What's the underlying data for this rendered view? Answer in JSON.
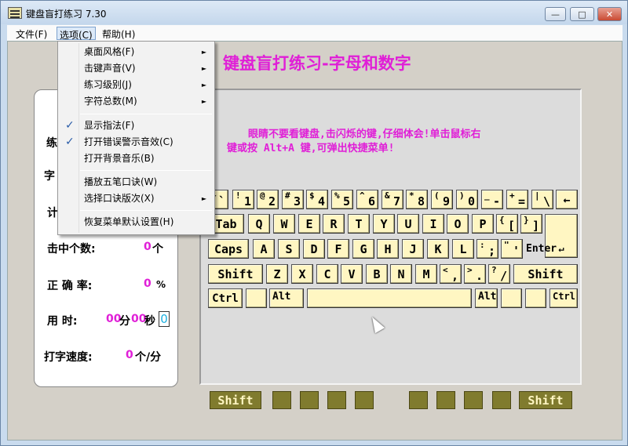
{
  "window": {
    "title": "键盘盲打练习 7.30",
    "buttons": {
      "minimize": "—",
      "maximize": "□",
      "close": "✕"
    }
  },
  "menubar": {
    "items": [
      "文件(F)",
      "选项(C)",
      "帮助(H)"
    ]
  },
  "options_menu": {
    "items": [
      {
        "label": "桌面风格(F)",
        "submenu": true,
        "checked": false
      },
      {
        "label": "击键声音(V)",
        "submenu": true,
        "checked": false
      },
      {
        "label": "练习级别(J)",
        "submenu": true,
        "checked": false
      },
      {
        "label": "字符总数(M)",
        "submenu": true,
        "checked": false
      },
      {
        "label": "显示指法(F)",
        "submenu": false,
        "checked": true
      },
      {
        "label": "打开错误警示音效(C)",
        "submenu": false,
        "checked": true
      },
      {
        "label": "打开背景音乐(B)",
        "submenu": false,
        "checked": false
      },
      {
        "label": "播放五笔口诀(W)",
        "submenu": false,
        "checked": false
      },
      {
        "label": "选择口诀版次(X)",
        "submenu": true,
        "checked": false
      },
      {
        "label": "恢复菜单默认设置(H)",
        "submenu": false,
        "checked": false
      }
    ],
    "arrow": "►",
    "check": "✓"
  },
  "heading": "键盘盲打练习-字母和数字",
  "hint": {
    "line1": "眼睛不要看键盘,击闪烁的键,仔细体会!单击鼠标右",
    "line2": "键或按 Alt+A 键,可弹出快捷菜单!"
  },
  "stats": {
    "partial_label_1": "练",
    "partial_label_2": "字",
    "partial_label_3": "计",
    "hits_label": "击中个数:",
    "hits_value": "0",
    "hits_unit": "个",
    "accuracy_label": "正 确 率:",
    "accuracy_value": "0",
    "accuracy_unit": "%",
    "time_label": "用  时:",
    "time_min": "00",
    "time_min_unit": "分",
    "time_sec": "00",
    "time_sec_unit": "秒",
    "time_box": "0",
    "speed_label": "打字速度:",
    "speed_value": "0",
    "speed_unit": "个/分"
  },
  "keyboard": {
    "row1": [
      {
        "top": "~",
        "bottom": "`"
      },
      {
        "top": "!",
        "bottom": "1"
      },
      {
        "top": "@",
        "bottom": "2"
      },
      {
        "top": "#",
        "bottom": "3"
      },
      {
        "top": "$",
        "bottom": "4"
      },
      {
        "top": "%",
        "bottom": "5"
      },
      {
        "top": "^",
        "bottom": "6"
      },
      {
        "top": "&",
        "bottom": "7"
      },
      {
        "top": "*",
        "bottom": "8"
      },
      {
        "top": "(",
        "bottom": "9"
      },
      {
        "top": ")",
        "bottom": "0"
      },
      {
        "top": "_",
        "bottom": "-"
      },
      {
        "top": "+",
        "bottom": "="
      },
      {
        "top": "|",
        "bottom": "\\"
      },
      {
        "top": "",
        "bottom": "←"
      }
    ],
    "row2": [
      "Tab",
      "Q",
      "W",
      "E",
      "R",
      "T",
      "Y",
      "U",
      "I",
      "O",
      "P"
    ],
    "row2_dual": [
      {
        "top": "{",
        "bottom": "["
      },
      {
        "top": "}",
        "bottom": "]"
      }
    ],
    "row3": [
      "Caps",
      "A",
      "S",
      "D",
      "F",
      "G",
      "H",
      "J",
      "K",
      "L"
    ],
    "row3_dual": [
      {
        "top": ":",
        "bottom": ";"
      },
      {
        "top": "\"",
        "bottom": "'"
      }
    ],
    "enter": "Enter",
    "enter_arrow": "↵",
    "row4": [
      "Shift",
      "Z",
      "X",
      "C",
      "V",
      "B",
      "N",
      "M"
    ],
    "row4_dual": [
      {
        "top": "<",
        "bottom": ","
      },
      {
        "top": ">",
        "bottom": "."
      },
      {
        "top": "?",
        "bottom": "/"
      }
    ],
    "row4_right": "Shift",
    "row5": {
      "ctrl_left": "Ctrl",
      "alt_left": "Alt",
      "alt_right": "Alt",
      "ctrl_right": "Ctrl"
    }
  },
  "finger_bar": {
    "left": "Shift",
    "right": "Shift"
  }
}
